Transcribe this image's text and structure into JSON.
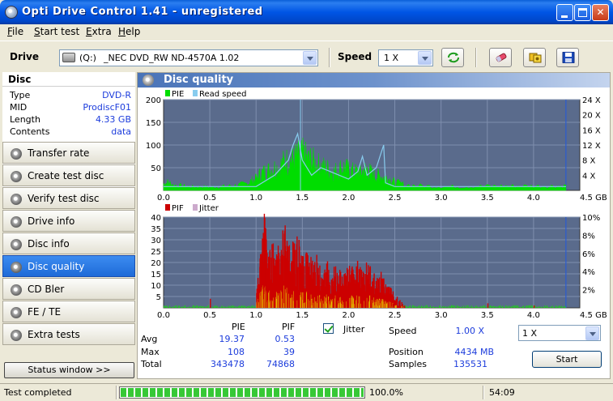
{
  "window": {
    "title": "Opti Drive Control 1.41 - unregistered"
  },
  "menu": [
    "File",
    "Start test",
    "Extra",
    "Help"
  ],
  "toolbar": {
    "drive_label": "Drive",
    "drive_letter": "(Q:)",
    "drive_name": "_NEC DVD_RW ND-4570A 1.02",
    "speed_label": "Speed",
    "speed_value": "1 X",
    "icons": [
      "refresh-icon",
      "eraser-icon",
      "copy-icon",
      "save-icon"
    ]
  },
  "disc": {
    "header": "Disc",
    "fields": [
      {
        "key": "Type",
        "value": "DVD-R"
      },
      {
        "key": "MID",
        "value": "ProdiscF01"
      },
      {
        "key": "Length",
        "value": "4.33 GB"
      },
      {
        "key": "Contents",
        "value": "data"
      }
    ]
  },
  "nav": [
    {
      "label": "Transfer rate",
      "active": false
    },
    {
      "label": "Create test disc",
      "active": false
    },
    {
      "label": "Verify test disc",
      "active": false
    },
    {
      "label": "Drive info",
      "active": false
    },
    {
      "label": "Disc info",
      "active": false
    },
    {
      "label": "Disc quality",
      "active": true
    },
    {
      "label": "CD Bler",
      "active": false
    },
    {
      "label": "FE / TE",
      "active": false
    },
    {
      "label": "Extra tests",
      "active": false
    }
  ],
  "status_window_label": "Status window >>",
  "panel_title": "Disc quality",
  "chart_data": [
    {
      "type": "area",
      "legend": [
        "PIE",
        "Read speed"
      ],
      "colors": {
        "PIE": "#00dd00",
        "Read speed": "#88ccee",
        "background": "#5a6b8c",
        "grid": "#7f8fae"
      },
      "x_ticks": [
        "0.0",
        "0.5",
        "1.0",
        "1.5",
        "2.0",
        "2.5",
        "3.0",
        "3.5",
        "4.0",
        "4.5 GB"
      ],
      "xlim": [
        0,
        4.5
      ],
      "y_ticks_left": [
        "200",
        "150",
        "100",
        "50"
      ],
      "ylim_left": [
        0,
        200
      ],
      "y_ticks_right": [
        "24 X",
        "20 X",
        "16 X",
        "12 X",
        "8 X",
        "4 X"
      ],
      "ylim_right": [
        0,
        24
      ],
      "pie_series": [
        [
          0.0,
          18
        ],
        [
          0.05,
          22
        ],
        [
          0.1,
          15
        ],
        [
          0.2,
          12
        ],
        [
          0.3,
          10
        ],
        [
          0.4,
          10
        ],
        [
          0.5,
          9
        ],
        [
          0.6,
          10
        ],
        [
          0.7,
          12
        ],
        [
          0.8,
          14
        ],
        [
          0.9,
          18
        ],
        [
          0.95,
          25
        ],
        [
          1.0,
          30
        ],
        [
          1.05,
          45
        ],
        [
          1.1,
          50
        ],
        [
          1.15,
          55
        ],
        [
          1.2,
          60
        ],
        [
          1.25,
          62
        ],
        [
          1.3,
          75
        ],
        [
          1.35,
          80
        ],
        [
          1.4,
          85
        ],
        [
          1.45,
          90
        ],
        [
          1.5,
          95
        ],
        [
          1.55,
          85
        ],
        [
          1.6,
          80
        ],
        [
          1.65,
          70
        ],
        [
          1.7,
          65
        ],
        [
          1.75,
          60
        ],
        [
          1.8,
          55
        ],
        [
          1.85,
          50
        ],
        [
          1.9,
          58
        ],
        [
          1.95,
          62
        ],
        [
          2.0,
          55
        ],
        [
          2.05,
          50
        ],
        [
          2.1,
          48
        ],
        [
          2.15,
          52
        ],
        [
          2.2,
          58
        ],
        [
          2.25,
          45
        ],
        [
          2.3,
          40
        ],
        [
          2.35,
          38
        ],
        [
          2.4,
          35
        ],
        [
          2.45,
          30
        ],
        [
          2.5,
          22
        ],
        [
          2.6,
          16
        ],
        [
          2.8,
          12
        ],
        [
          3.0,
          11
        ],
        [
          3.2,
          10
        ],
        [
          3.4,
          11
        ],
        [
          3.6,
          12
        ],
        [
          3.8,
          12
        ],
        [
          4.0,
          12
        ],
        [
          4.2,
          12
        ],
        [
          4.35,
          12
        ]
      ],
      "read_speed_series": [
        [
          0.0,
          1
        ],
        [
          0.2,
          1
        ],
        [
          0.5,
          1
        ],
        [
          1.0,
          1
        ],
        [
          1.2,
          4
        ],
        [
          1.35,
          8
        ],
        [
          1.4,
          12
        ],
        [
          1.45,
          15
        ],
        [
          1.5,
          8
        ],
        [
          1.6,
          4
        ],
        [
          1.7,
          6
        ],
        [
          2.0,
          3
        ],
        [
          2.1,
          5
        ],
        [
          2.15,
          9
        ],
        [
          2.2,
          4
        ],
        [
          2.3,
          6
        ],
        [
          2.38,
          12
        ],
        [
          2.4,
          2
        ],
        [
          2.5,
          1
        ],
        [
          3.0,
          1
        ],
        [
          3.5,
          1
        ],
        [
          4.0,
          1
        ],
        [
          4.35,
          1
        ]
      ],
      "pie_max": 108
    },
    {
      "type": "bar",
      "legend": [
        "PIF",
        "Jitter"
      ],
      "colors": {
        "PIF": "#cc0000",
        "Jitter": "#ccaacc",
        "background": "#5a6b8c",
        "grid": "#7f8fae"
      },
      "x_ticks": [
        "0.0",
        "0.5",
        "1.0",
        "1.5",
        "2.0",
        "2.5",
        "3.0",
        "3.5",
        "4.0",
        "4.5 GB"
      ],
      "xlim": [
        0,
        4.5
      ],
      "y_ticks_left": [
        "40",
        "35",
        "30",
        "25",
        "20",
        "15",
        "10",
        "5"
      ],
      "ylim_left": [
        0,
        40
      ],
      "y_ticks_right": [
        "10%",
        "8%",
        "6%",
        "4%",
        "2%"
      ],
      "ylim_right": [
        0,
        10
      ],
      "pif_series": [
        [
          0.5,
          4
        ],
        [
          1.0,
          6
        ],
        [
          1.02,
          15
        ],
        [
          1.05,
          25
        ],
        [
          1.08,
          39
        ],
        [
          1.1,
          30
        ],
        [
          1.12,
          18
        ],
        [
          1.15,
          28
        ],
        [
          1.2,
          32
        ],
        [
          1.25,
          22
        ],
        [
          1.3,
          35
        ],
        [
          1.35,
          28
        ],
        [
          1.4,
          25
        ],
        [
          1.45,
          30
        ],
        [
          1.5,
          20
        ],
        [
          1.55,
          24
        ],
        [
          1.6,
          18
        ],
        [
          1.65,
          22
        ],
        [
          1.7,
          16
        ],
        [
          1.75,
          20
        ],
        [
          1.8,
          14
        ],
        [
          1.85,
          18
        ],
        [
          1.9,
          16
        ],
        [
          1.95,
          14
        ],
        [
          2.0,
          18
        ],
        [
          2.05,
          15
        ],
        [
          2.1,
          19
        ],
        [
          2.15,
          16
        ],
        [
          2.2,
          20
        ],
        [
          2.25,
          15
        ],
        [
          2.3,
          12
        ],
        [
          2.35,
          14
        ],
        [
          2.4,
          10
        ],
        [
          2.45,
          8
        ],
        [
          2.48,
          6
        ],
        [
          2.6,
          1
        ],
        [
          3.5,
          2
        ],
        [
          4.0,
          1
        ]
      ]
    }
  ],
  "stats": {
    "col_pie": "PIE",
    "col_pif": "PIF",
    "jitter_label": "Jitter",
    "rows": [
      {
        "label": "Avg",
        "pie": "19.37",
        "pif": "0.53"
      },
      {
        "label": "Max",
        "pie": "108",
        "pif": "39"
      },
      {
        "label": "Total",
        "pie": "343478",
        "pif": "74868"
      }
    ],
    "speed_label": "Speed",
    "speed_value": "1.00 X",
    "position_label": "Position",
    "position_value": "4434 MB",
    "samples_label": "Samples",
    "samples_value": "135531",
    "speed_select": "1 X",
    "start_label": "Start"
  },
  "statusbar": {
    "text": "Test completed",
    "progress_pct": 100,
    "progress_text": "100.0%",
    "time": "54:09"
  }
}
